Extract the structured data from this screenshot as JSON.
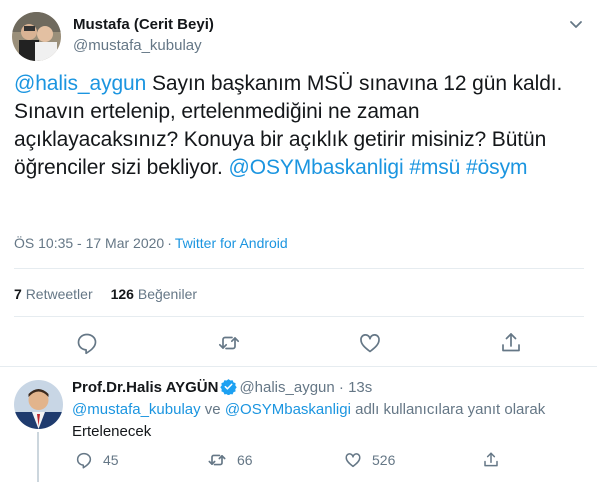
{
  "tweet": {
    "author_name": "Mustafa (Cerit Beyi)",
    "author_handle": "@mustafa_kubulay",
    "mention_start": "@halis_aygun",
    "text_body": " Sayın başkanım MSÜ sınavına 12 gün kaldı. Sınavın ertelenip, ertelenmediğini ne zaman açıklayacaksınız? Konuya bir açıklık getirir misiniz? Bütün öğrenciler sizi bekliyor. ",
    "mention_osym": "@OSYMbaskanligi",
    "hashtag_msu": "#msü",
    "hashtag_osym": "#ösym",
    "time": "ÖS 10:35 - 17 Mar 2020",
    "separator": "·",
    "source": "Twitter for Android",
    "retweets_count": "7",
    "retweets_label": "Retweetler",
    "likes_count": "126",
    "likes_label": "Beğeniler"
  },
  "reply": {
    "author_name": "Prof.Dr.Halis AYGÜN",
    "author_handle": "@halis_aygun",
    "dot": "·",
    "time": "13s",
    "reply_to_user1": "@mustafa_kubulay",
    "reply_to_conj": " ve ",
    "reply_to_user2": "@OSYMbaskanligi",
    "reply_to_suffix": " adlı kullanıcılara yanıt olarak",
    "text": "Ertelenecek",
    "reply_count": "45",
    "retweet_count": "66",
    "like_count": "526"
  },
  "icons": {
    "caret": "chevron-down-icon",
    "reply": "reply-icon",
    "retweet": "retweet-icon",
    "like": "heart-icon",
    "share": "share-icon",
    "verified": "verified-badge-icon"
  },
  "colors": {
    "link": "#1b95e0",
    "muted": "#657786",
    "text": "#14171a",
    "divider": "#e6ecf0",
    "verified": "#1da1f2"
  }
}
